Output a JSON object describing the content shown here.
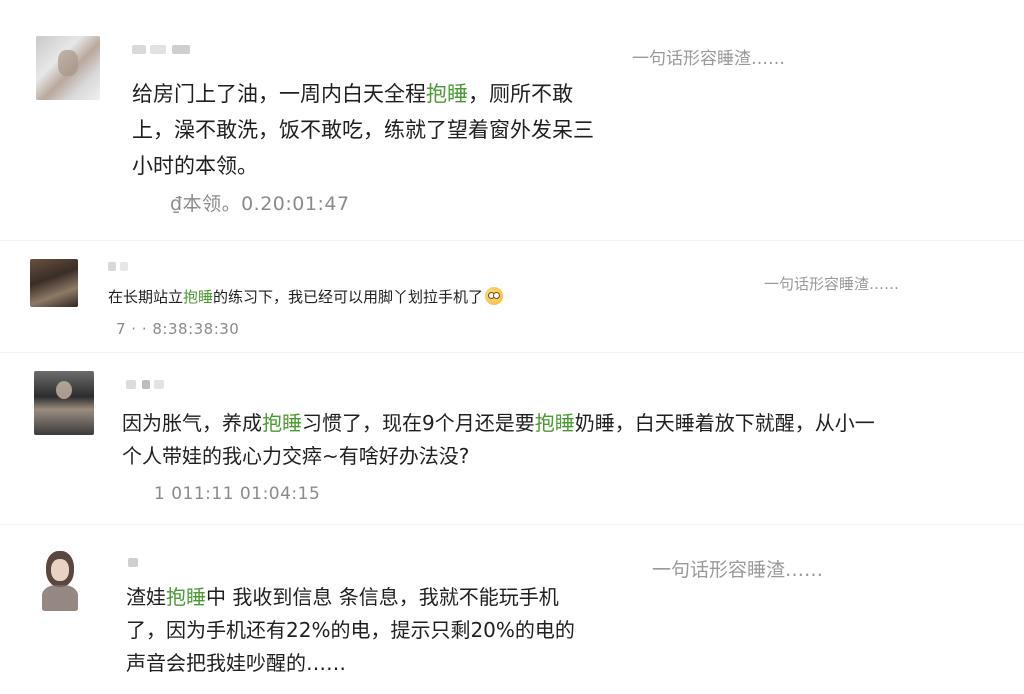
{
  "comments": [
    {
      "source": "一句话形容睡渣……",
      "text_before": "给房门上了油，一周内白天全程",
      "highlight": "抱睡",
      "text_after": "，厕所不敢\n上，澡不敢洗，饭不敢吃，练就了望着窗外发呆三\n小时的本领。",
      "timestamp": "₫本领。0.20:01:47"
    },
    {
      "source": "一句话形容睡渣……",
      "text_before": "在长期站立",
      "highlight": "抱睡",
      "text_after": "的练习下，我已经可以用脚丫划拉手机了",
      "emoji": "dizzy-face-emoji",
      "timestamp": "7 · · 8:38:38:30"
    },
    {
      "source": "",
      "text_before": "因为胀气，养成",
      "highlight": "抱睡",
      "text_middle": "习惯了，现在9个月还是要",
      "highlight2": "抱睡",
      "text_after": "奶睡，白天睡着放下就醒，从小一\n个人带娃的我心力交瘁~有啥好办法没?",
      "timestamp": "1 011:11 01:04:15"
    },
    {
      "source": "一句话形容睡渣……",
      "text_before": "渣娃",
      "highlight": "抱睡",
      "text_after": "中 我收到信息 条信息，我就不能玩手机\n了，因为手机还有22%的电，提示只剩20%的电的\n声音会把我娃吵醒的……",
      "timestamp": ""
    }
  ],
  "colors": {
    "highlight": "#4c9a33",
    "source": "#9a9a9a",
    "timestamp": "#8b8b8b"
  }
}
